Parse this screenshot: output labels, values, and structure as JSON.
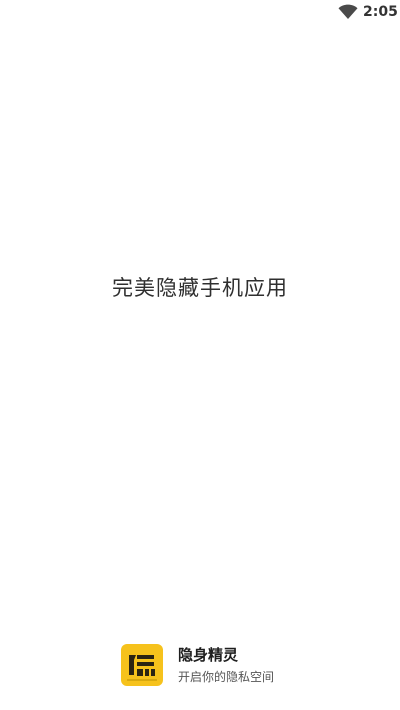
{
  "status_bar": {
    "time": "2:05",
    "icons": [
      "wifi-icon"
    ]
  },
  "splash": {
    "slogan": "完美隐藏手机应用"
  },
  "brand": {
    "logo_icon": "app-logo-icon",
    "logo_color": "#f6c21c",
    "name": "隐身精灵",
    "tagline": "开启你的隐私空间"
  }
}
